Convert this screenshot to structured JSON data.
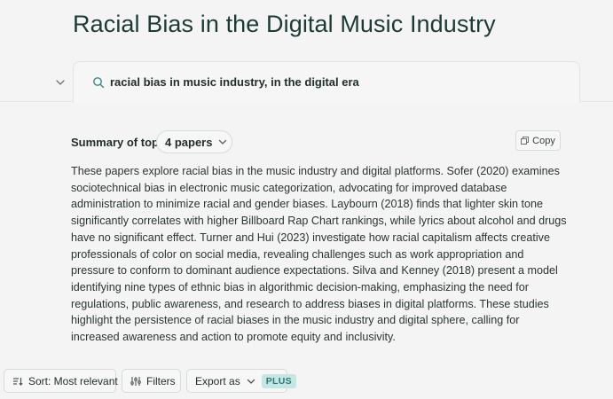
{
  "header": {
    "title": "Racial Bias in the Digital Music Industry"
  },
  "search": {
    "query": "racial bias in music industry, in the digital era"
  },
  "summary": {
    "label": "Summary of top",
    "papers_selected": "4 papers",
    "copy_label": "Copy",
    "text": "These papers explore racial bias in the music industry and digital platforms. Sofer (2020) examines sociotechnical bias in electronic music categorization, advocating for improved database administration to minimize racial and gender biases. Laybourn (2018) finds that lighter skin tone significantly correlates with higher Billboard Rap Chart rankings, while lyrics about alcohol and drugs have no significant effect. Turner and Hui (2023) investigate how racial capitalism affects creative professionals of color on social media, revealing challenges such as work appropriation and pressure to conform to dominant audience expectations. Silva and Kenney (2018) present a model identifying nine types of ethnic bias in algorithmic decision-making, emphasizing the need for regulations, public awareness, and research to address biases in digital platforms. These studies highlight the persistence of racial biases in the music industry and digital sphere, calling for increased awareness and action to promote equity and inclusivity."
  },
  "toolbar": {
    "sort_label": "Sort: Most relevant",
    "filters_label": "Filters",
    "export_label": "Export as",
    "plus_badge": "PLUS"
  },
  "colors": {
    "background": "#f3f4f3",
    "title": "#1d3b36",
    "accent": "#3a8a86",
    "plus_badge_bg": "#c6e6e3"
  },
  "icons": [
    "chevron-down-icon",
    "search-icon",
    "copy-icon",
    "sort-icon",
    "filter-sliders-icon"
  ]
}
